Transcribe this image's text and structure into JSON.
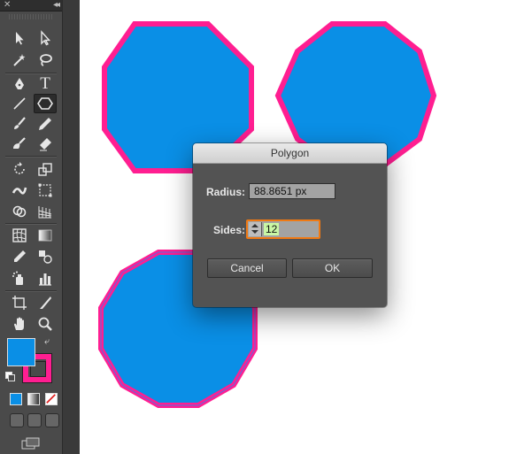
{
  "toolbar": {
    "close_glyph": "✕",
    "collapse_glyph": "◂◂",
    "tools": [
      "selection-tool",
      "direct-selection-tool",
      "magic-wand-tool",
      "lasso-tool",
      "pen-tool",
      "type-tool",
      "line-segment-tool",
      "polygon-tool",
      "paintbrush-tool",
      "pencil-tool",
      "blob-brush-tool",
      "eraser-tool",
      "rotate-tool",
      "scale-tool",
      "width-tool",
      "free-transform-tool",
      "shape-builder-tool",
      "perspective-grid-tool",
      "mesh-tool",
      "gradient-tool",
      "eyedropper-tool",
      "blend-tool",
      "symbol-sprayer-tool",
      "column-graph-tool",
      "artboard-tool",
      "slice-tool",
      "hand-tool",
      "zoom-tool"
    ],
    "active_tool": "polygon-tool",
    "fill_color": "#0a8fe6",
    "stroke_color": "#ff1e91",
    "type_glyph": "T",
    "swap_glyph": "⤶"
  },
  "canvas": {
    "background": "#ffffff",
    "shape_fill": "#0a8fe6",
    "shape_stroke": "#ff1e91",
    "selection_color": "#5b6ee0"
  },
  "dialog": {
    "title": "Polygon",
    "radius_label": "Radius:",
    "radius_value": "88.8651 px",
    "sides_label": "Sides:",
    "sides_value": "12",
    "cancel_label": "Cancel",
    "ok_label": "OK"
  }
}
